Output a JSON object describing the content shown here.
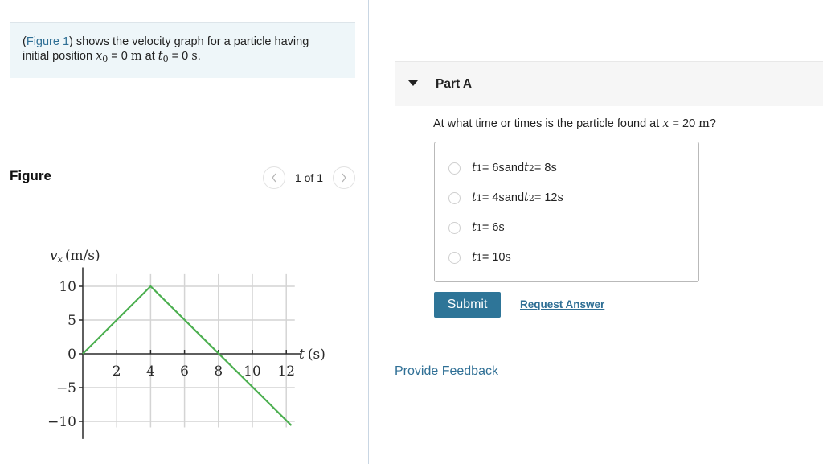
{
  "intro": {
    "link_text": "Figure 1",
    "text_before_link": "(",
    "text_after_link": ") shows the velocity graph for a particle having",
    "line2_prefix": "initial position ",
    "x0_var": "x",
    "x0_sub": "0",
    "x0_eq": " = 0 ",
    "x0_unit": "m",
    "at_text": " at ",
    "t0_var": "t",
    "t0_sub": "0",
    "t0_eq": " = 0 ",
    "t0_unit": "s",
    "end": "."
  },
  "figure": {
    "title": "Figure",
    "pager_text": "1 of 1",
    "prev_icon": "chevron-left-icon",
    "next_icon": "chevron-right-icon"
  },
  "chart_data": {
    "type": "line",
    "title": "",
    "xlabel": "t (s)",
    "ylabel": "vx (m/s)",
    "ylabel_var": "v",
    "ylabel_sub": "x",
    "ylabel_unit": "(m/s)",
    "xlabel_var": "t",
    "xlabel_unit": "(s)",
    "xlim": [
      0,
      12.5
    ],
    "ylim": [
      -12,
      12
    ],
    "x_ticks": [
      2,
      4,
      6,
      8,
      10,
      12
    ],
    "y_ticks": [
      10,
      5,
      0,
      -5,
      -10
    ],
    "y_tick_labels": [
      "10",
      "5",
      "0",
      "−5",
      "−10"
    ],
    "x_tick_labels": [
      "2",
      "4",
      "6",
      "8",
      "10",
      "12"
    ],
    "grid": true,
    "series": [
      {
        "name": "velocity",
        "color": "#4caf50",
        "x": [
          0,
          4,
          12.3
        ],
        "y": [
          0,
          10,
          -10.6
        ]
      }
    ]
  },
  "partA": {
    "title": "Part A",
    "question_prefix": "At what time or times is the particle found at ",
    "question_var": "x",
    "question_eq": " = 20 ",
    "question_unit": "m",
    "question_suffix": "?",
    "options": [
      {
        "t1": "6",
        "t2": "8",
        "text1": " = 6 ",
        "and": " and ",
        "text2": " = 8 "
      },
      {
        "t1": "4",
        "t2": "12",
        "text1": " = 4 ",
        "and": " and ",
        "text2": " = 12 "
      },
      {
        "t1": "6",
        "text1": " = 6 "
      },
      {
        "t1": "10",
        "text1": " = 10 "
      }
    ],
    "unit_s": "s",
    "var_t": "t",
    "sub1": "1",
    "sub2": "2",
    "submit_label": "Submit",
    "request_label": "Request Answer"
  },
  "feedback_label": "Provide Feedback",
  "colors": {
    "accent": "#2e7598",
    "link": "#2f6f95",
    "line": "#4caf50",
    "intro_bg": "#eef6f9"
  }
}
